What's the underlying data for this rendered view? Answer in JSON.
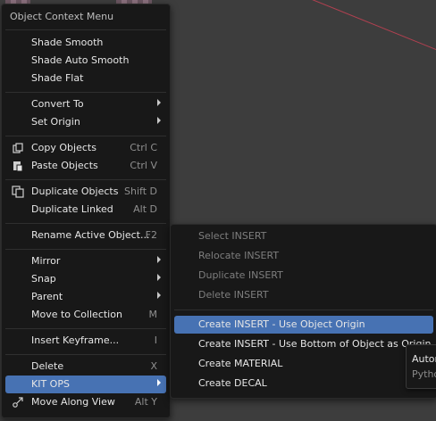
{
  "main_menu": {
    "title": "Object Context Menu",
    "items": [
      {
        "label": "Shade Smooth",
        "shortcut": "",
        "submenu": false
      },
      {
        "label": "Shade Auto Smooth",
        "shortcut": "",
        "submenu": false
      },
      {
        "label": "Shade Flat",
        "shortcut": "",
        "submenu": false
      },
      {
        "label": "Convert To",
        "shortcut": "",
        "submenu": true
      },
      {
        "label": "Set Origin",
        "shortcut": "",
        "submenu": true
      },
      {
        "label": "Copy Objects",
        "shortcut": "Ctrl C",
        "icon": "copy-icon"
      },
      {
        "label": "Paste Objects",
        "shortcut": "Ctrl V",
        "icon": "paste-icon"
      },
      {
        "label": "Duplicate Objects",
        "shortcut": "Shift D",
        "icon": "duplicate-icon"
      },
      {
        "label": "Duplicate Linked",
        "shortcut": "Alt D"
      },
      {
        "label": "Rename Active Object...",
        "shortcut": "F2"
      },
      {
        "label": "Mirror",
        "shortcut": "",
        "submenu": true
      },
      {
        "label": "Snap",
        "shortcut": "",
        "submenu": true
      },
      {
        "label": "Parent",
        "shortcut": "",
        "submenu": true
      },
      {
        "label": "Move to Collection",
        "shortcut": "M"
      },
      {
        "label": "Insert Keyframe...",
        "shortcut": "I"
      },
      {
        "label": "Delete",
        "shortcut": "X"
      },
      {
        "label": "KIT OPS",
        "shortcut": "",
        "submenu": true,
        "active": true
      },
      {
        "label": "Move Along View",
        "shortcut": "Alt Y",
        "icon": "move-along-view-icon"
      }
    ]
  },
  "kitops_menu": {
    "items": [
      {
        "label": "Select INSERT",
        "disabled": true
      },
      {
        "label": "Relocate INSERT",
        "disabled": true
      },
      {
        "label": "Duplicate INSERT",
        "disabled": true
      },
      {
        "label": "Delete INSERT",
        "disabled": true
      },
      {
        "label": "Create INSERT - Use Object Origin",
        "active": true
      },
      {
        "label": "Create INSERT - Use Bottom of Object as Origin"
      },
      {
        "label": "Create MATERIAL"
      },
      {
        "label": "Create DECAL"
      }
    ]
  },
  "tooltip": {
    "line1": "Autom",
    "line2": "Pytho"
  },
  "colors": {
    "highlight": "#4772b3",
    "menu_bg": "#181818",
    "viewport_bg": "#3d3d3d"
  }
}
